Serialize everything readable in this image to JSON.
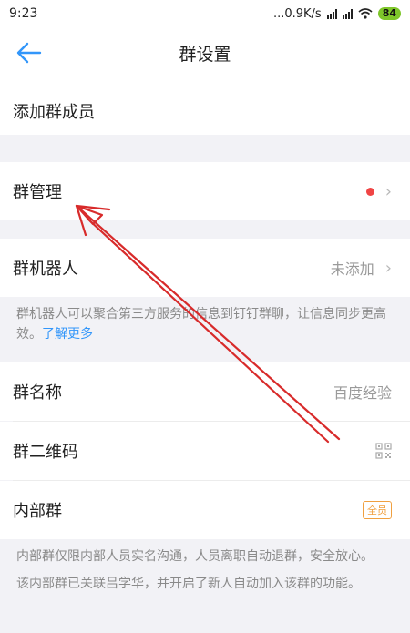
{
  "status_bar": {
    "time": "9:23",
    "network_speed": "...0.9K/s",
    "battery": "84"
  },
  "header": {
    "title": "群设置",
    "back_icon": "arrow-left-icon"
  },
  "rows": {
    "add_member": {
      "label": "添加群成员"
    },
    "group_manage": {
      "label": "群管理",
      "has_red_dot": true
    },
    "group_robot": {
      "label": "群机器人",
      "value": "未添加"
    },
    "group_name": {
      "label": "群名称",
      "value": "百度经验"
    },
    "group_qr": {
      "label": "群二维码",
      "icon": "qr-code-icon"
    },
    "internal_group": {
      "label": "内部群",
      "badge": "全员"
    }
  },
  "robot_note": {
    "text": "群机器人可以聚合第三方服务的信息到钉钉群聊，让信息同步更高效。",
    "link": "了解更多"
  },
  "internal_note_1": "内部群仅限内部人员实名沟通，人员离职自动退群，安全放心。",
  "internal_note_2": "该内部群已关联吕学华，并开启了新人自动加入该群的功能。",
  "colors": {
    "accent": "#3296fa",
    "red_dot": "#f04545",
    "annotation_arrow": "#d82b2b",
    "badge": "#f0a040"
  }
}
